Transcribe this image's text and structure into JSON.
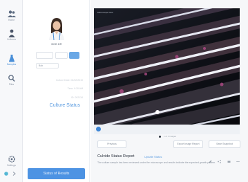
{
  "nav": {
    "items": [
      {
        "label": "Home",
        "icon": "people-icon"
      },
      {
        "label": "Cultures",
        "icon": "person-icon"
      },
      {
        "label": "Samples",
        "icon": "flask-icon"
      },
      {
        "label": "Files",
        "icon": "search-icon"
      }
    ],
    "bottom": {
      "label": "Settings",
      "icon": "gear-icon"
    }
  },
  "profile": {
    "name": "BOB DR",
    "select_value": "Bob",
    "meta": [
      "Culture Date: 02/02/2019",
      "Time: 9:30 AM",
      "ID: 092134"
    ],
    "culture_status": "Culture Status",
    "action_button": "Status of Results"
  },
  "viewer": {
    "caption": "Microscope View",
    "pager": "1 of 4 images"
  },
  "buttons": {
    "left": "Previous",
    "middle": "Export Image Report",
    "right": "Save Snapshot"
  },
  "card": {
    "title": "Culvide Status Report",
    "link": "Update Status",
    "description": "The culture sample has been reviewed under the microscope and results indicate the expected growth pattern."
  },
  "colors": {
    "accent": "#4d93e3",
    "link": "#5a9be0",
    "viewer_bg": "#0e1016"
  }
}
